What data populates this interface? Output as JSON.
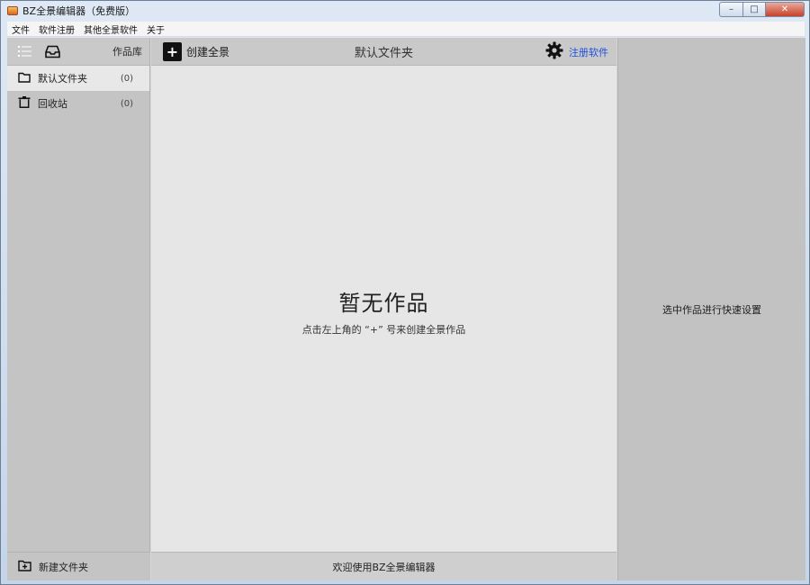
{
  "window": {
    "title": "BZ全景编辑器（免费版）",
    "controls": {
      "minimize": "–",
      "maximize": "□",
      "close": "✕"
    }
  },
  "menu": [
    "文件",
    "软件注册",
    "其他全景软件",
    "关于"
  ],
  "sidebar": {
    "library_label": "作品库",
    "folders": [
      {
        "label": "默认文件夹",
        "count": "(0)",
        "icon": "folder-icon",
        "selected": true
      },
      {
        "label": "回收站",
        "count": "(0)",
        "icon": "trash-icon",
        "selected": false
      }
    ],
    "new_folder_label": "新建文件夹"
  },
  "toolbar": {
    "create_label": "创建全景",
    "plus_glyph": "+",
    "current_folder": "默认文件夹",
    "register_label": "注册软件"
  },
  "main": {
    "empty_title": "暂无作品",
    "empty_hint": "点击左上角的 “+” 号来创建全景作品"
  },
  "status": {
    "welcome": "欢迎使用BZ全景编辑器"
  },
  "right_panel": {
    "hint": "选中作品进行快速设置"
  },
  "colors": {
    "accent_link": "#1d4fe0",
    "selected_row": "#e8e8e8"
  }
}
